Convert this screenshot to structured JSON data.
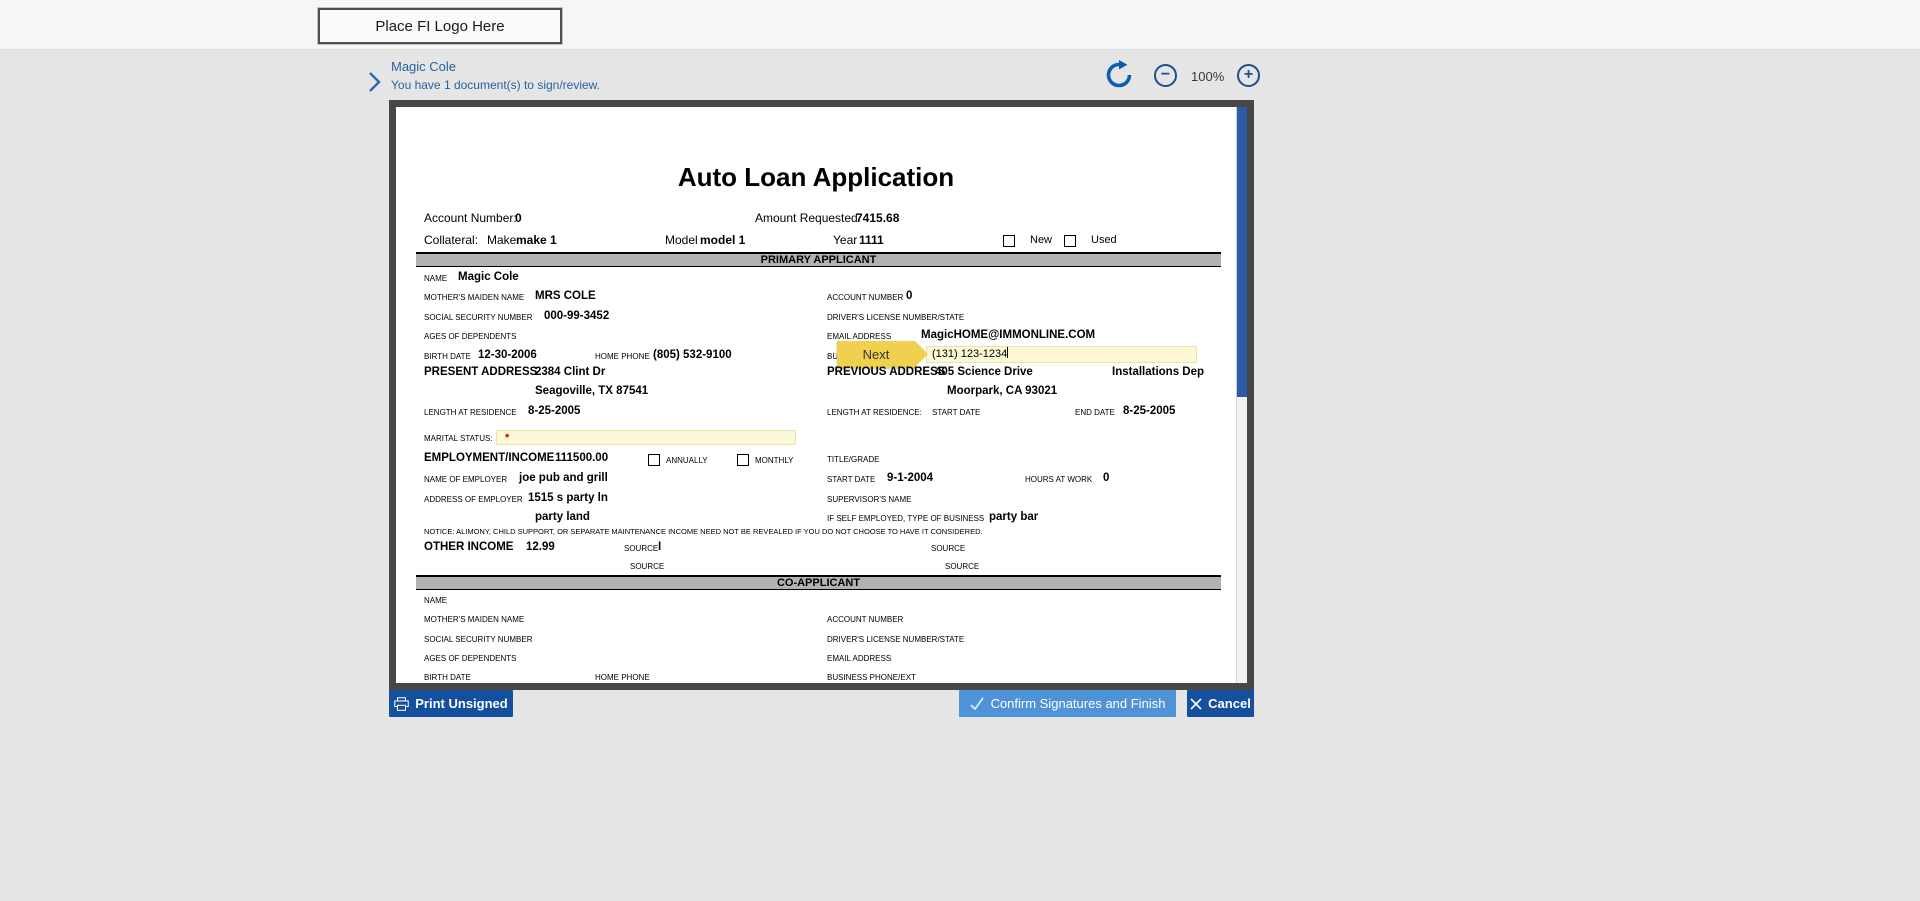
{
  "top_bar": {
    "logo_placeholder": "Place FI Logo Here"
  },
  "header": {
    "user_name": "Magic Cole",
    "message": "You have 1 document(s) to sign/review.",
    "zoom_level": "100%",
    "zoom_out_glyph": "−",
    "zoom_in_glyph": "+"
  },
  "form": {
    "title": "Auto Loan Application",
    "account_number_label": "Account Number:",
    "account_number_value": "0",
    "amount_requested_label": "Amount Requested",
    "amount_requested_value": "7415.68",
    "collateral_label": "Collateral:",
    "make_label": "Make",
    "make_value": "make 1",
    "model_label": "Model",
    "model_value": "model 1",
    "year_label": "Year",
    "year_value": "1111",
    "new_label": "New",
    "used_label": "Used",
    "primary_section_title": "PRIMARY APPLICANT",
    "primary": {
      "name_label": "NAME",
      "name_value": "Magic Cole",
      "maiden_label": "MOTHER'S MAIDEN NAME",
      "maiden_value": "MRS COLE",
      "ssn_label": "SOCIAL SECURITY NUMBER",
      "ssn_value": "000-99-3452",
      "dependents_label": "AGES OF DEPENDENTS",
      "birth_label": "BIRTH DATE",
      "birth_value": "12-30-2006",
      "home_phone_label": "HOME PHONE",
      "home_phone_value": "(805) 532-9100",
      "account_label": "ACCOUNT NUMBER",
      "account_value": "0",
      "license_label": "DRIVER'S LICENSE NUMBER/STATE",
      "email_label": "EMAIL ADDRESS",
      "email_value": "MagicHOME@IMMONLINE.COM",
      "business_phone_label": "BUSINESS PHONE/EXT",
      "business_phone_value": "(131) 123-1234",
      "next_flag_label": "Next",
      "present_address_label": "PRESENT ADDRESS",
      "present_address_value": "2384 Clint Dr",
      "present_address_city": "Seagoville, TX 87541",
      "previous_address_label": "PREVIOUS ADDRESS",
      "previous_address_value": "405 Science Drive",
      "previous_address_extra": "Installations Dep",
      "previous_address_city": "Moorpark, CA 93021",
      "residence_label": "LENGTH AT RESIDENCE",
      "residence_value": "8-25-2005",
      "residence2_label": "LENGTH AT RESIDENCE:",
      "start_date_label": "START DATE",
      "end_date_label": "END DATE",
      "end_date_value": "8-25-2005",
      "marital_label": "MARITAL STATUS:",
      "marital_required": "*",
      "employment_label": "EMPLOYMENT/INCOME",
      "employment_value": "111500.00",
      "annually_label": "ANNUALLY",
      "monthly_label": "MONTHLY",
      "title_grade_label": "TITLE/GRADE",
      "employer_label": "NAME OF EMPLOYER",
      "employer_value": "joe pub and grill",
      "emp_start_value": "9-1-2004",
      "hours_label": "HOURS AT WORK",
      "hours_value": "0",
      "employer_address_label": "ADDRESS OF EMPLOYER",
      "employer_address_value": "1515 s party ln",
      "employer_address_city": "party land",
      "supervisor_label": "SUPERVISOR'S NAME",
      "self_employed_label": "IF SELF EMPLOYED, TYPE OF BUSINESS",
      "self_employed_value": "party bar",
      "notice": "NOTICE: ALIMONY, CHILD SUPPORT, OR SEPARATE MAINTENANCE INCOME NEED NOT BE REVEALED IF YOU DO NOT CHOOSE TO HAVE IT CONSIDERED.",
      "other_income_label": "OTHER INCOME",
      "other_income_value": "12.99",
      "source_label": "SOURCE",
      "source_value": "I"
    },
    "co_section_title": "CO-APPLICANT",
    "co": {
      "left_labels": [
        "NAME",
        "MOTHER'S MAIDEN NAME",
        "SOCIAL SECURITY NUMBER",
        "AGES OF DEPENDENTS",
        "BIRTH DATE"
      ],
      "home_phone_label": "HOME PHONE",
      "right_labels": [
        "ACCOUNT NUMBER",
        "DRIVER'S LICENSE NUMBER/STATE",
        "EMAIL ADDRESS",
        "BUSINESS PHONE/EXT"
      ]
    }
  },
  "footer": {
    "print_label": "Print Unsigned",
    "confirm_label": "Confirm Signatures and Finish",
    "cancel_label": "Cancel"
  },
  "colors": {
    "accent_blue": "#2563a0",
    "button_dark_blue": "#15509f",
    "button_light_blue": "#4e92d7",
    "scrollbar_blue": "#2d5ca6",
    "flag_yellow": "#f0d04f",
    "field_yellow": "#fcf7d5",
    "required_red": "#cc0000"
  }
}
